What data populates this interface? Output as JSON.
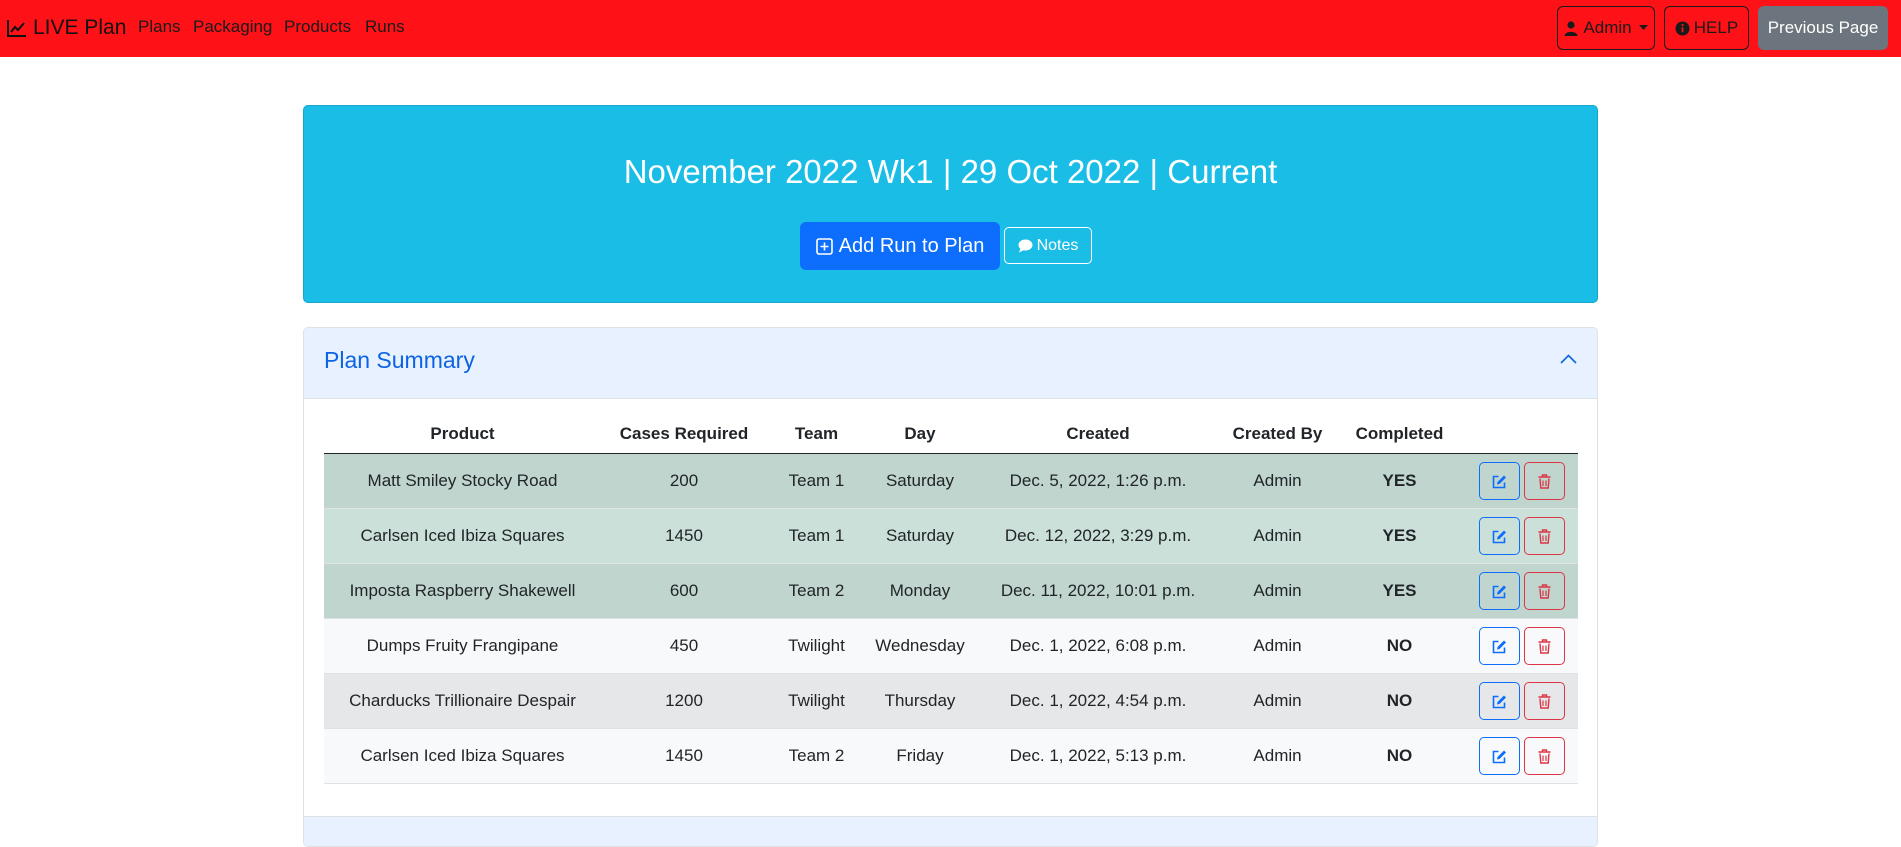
{
  "navbar": {
    "brand": "LIVE Plan",
    "links": [
      "Plans",
      "Packaging",
      "Products",
      "Runs"
    ],
    "admin_label": "Admin",
    "help_label": "HELP",
    "previous_label": "Previous Page",
    "bg_color": "#fe1217"
  },
  "hero": {
    "title": "November 2022 Wk1 | 29 Oct 2022 | Current",
    "add_run_label": "Add Run to Plan",
    "notes_label": "Notes"
  },
  "summary": {
    "title": "Plan Summary",
    "columns": [
      "Product",
      "Cases Required",
      "Team",
      "Day",
      "Created",
      "Created By",
      "Completed",
      ""
    ],
    "rows": [
      {
        "product": "Matt Smiley Stocky Road",
        "cases": "200",
        "team": "Team 1",
        "day": "Saturday",
        "created": "Dec. 5, 2022, 1:26 p.m.",
        "created_by": "Admin",
        "completed": "YES"
      },
      {
        "product": "Carlsen Iced Ibiza Squares",
        "cases": "1450",
        "team": "Team 1",
        "day": "Saturday",
        "created": "Dec. 12, 2022, 3:29 p.m.",
        "created_by": "Admin",
        "completed": "YES"
      },
      {
        "product": "Imposta Raspberry Shakewell",
        "cases": "600",
        "team": "Team 2",
        "day": "Monday",
        "created": "Dec. 11, 2022, 10:01 p.m.",
        "created_by": "Admin",
        "completed": "YES"
      },
      {
        "product": "Dumps Fruity Frangipane",
        "cases": "450",
        "team": "Twilight",
        "day": "Wednesday",
        "created": "Dec. 1, 2022, 6:08 p.m.",
        "created_by": "Admin",
        "completed": "NO"
      },
      {
        "product": "Charducks Trillionaire Despair",
        "cases": "1200",
        "team": "Twilight",
        "day": "Thursday",
        "created": "Dec. 1, 2022, 4:54 p.m.",
        "created_by": "Admin",
        "completed": "NO"
      },
      {
        "product": "Carlsen Iced Ibiza Squares",
        "cases": "1450",
        "team": "Team 2",
        "day": "Friday",
        "created": "Dec. 1, 2022, 5:13 p.m.",
        "created_by": "Admin",
        "completed": "NO"
      }
    ]
  },
  "icons": {
    "brand": "chart-line-icon",
    "admin": "user-icon",
    "help": "info-circle-icon",
    "add": "plus-square-icon",
    "notes": "comment-icon",
    "edit": "edit-icon",
    "delete": "trash-icon",
    "collapse": "chevron-up-icon"
  }
}
